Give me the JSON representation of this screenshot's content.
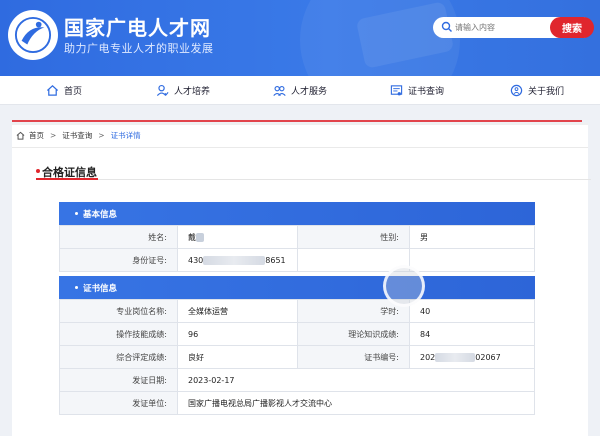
{
  "site": {
    "title": "国家广电人才网",
    "subtitle": "助力广电专业人才的职业发展"
  },
  "search": {
    "placeholder": "请输入内容",
    "button_label": "搜索"
  },
  "nav": {
    "items": [
      {
        "label": "首页",
        "icon": "home-icon"
      },
      {
        "label": "人才培养",
        "icon": "user-icon"
      },
      {
        "label": "人才服务",
        "icon": "users-icon"
      },
      {
        "label": "证书查询",
        "icon": "certificate-icon"
      },
      {
        "label": "关于我们",
        "icon": "info-icon"
      }
    ]
  },
  "breadcrumb": {
    "items": [
      "首页",
      "证书查询",
      "证书详情"
    ],
    "separator": ">"
  },
  "section": {
    "title": "合格证信息"
  },
  "basic_info": {
    "header": "基本信息",
    "name_label": "姓名:",
    "name_value": "戴",
    "gender_label": "性别:",
    "gender_value": "男",
    "id_label": "身份证号:",
    "id_prefix": "430",
    "id_suffix": "8651"
  },
  "cert_info": {
    "header": "证书信息",
    "rows": {
      "position_label": "专业岗位名称:",
      "position_value": "全媒体运营",
      "hours_label": "学时:",
      "hours_value": "40",
      "skill_label": "操作技能成绩:",
      "skill_value": "96",
      "theory_label": "理论知识成绩:",
      "theory_value": "84",
      "overall_label": "综合评定成绩:",
      "overall_value": "良好",
      "certno_label": "证书编号:",
      "certno_prefix": "202",
      "certno_suffix": "02067",
      "date_label": "发证日期:",
      "date_value": "2023-02-17",
      "issuer_label": "发证单位:",
      "issuer_value": "国家广播电视总局广播影视人才交流中心"
    }
  },
  "colors": {
    "brand_blue": "#2f6be0",
    "accent_red": "#e0262d"
  }
}
